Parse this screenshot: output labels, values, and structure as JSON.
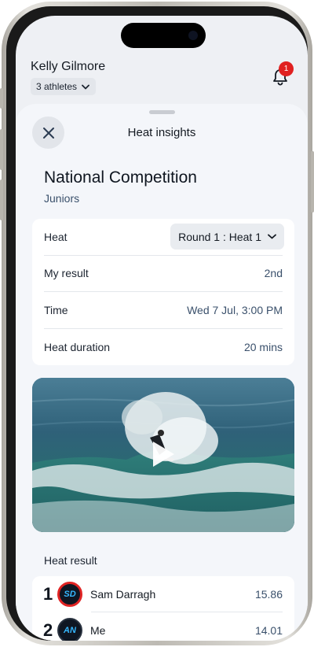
{
  "header": {
    "user_name": "Kelly Gilmore",
    "athletes_label": "3 athletes",
    "notification_count": "1"
  },
  "sheet": {
    "title": "Heat insights",
    "competition": "National Competition",
    "division": "Juniors"
  },
  "info": {
    "heat_label": "Heat",
    "heat_value": "Round 1 : Heat 1",
    "result_label": "My result",
    "result_value": "2nd",
    "time_label": "Time",
    "time_value": "Wed 7 Jul, 3:00 PM",
    "duration_label": "Heat duration",
    "duration_value": "20 mins"
  },
  "results": {
    "heading": "Heat result",
    "rows": [
      {
        "rank": "1",
        "initials": "SD",
        "name": "Sam Darragh",
        "score": "15.86"
      },
      {
        "rank": "2",
        "initials": "AN",
        "name": "Me",
        "score": "14.01"
      }
    ]
  },
  "colors": {
    "badge": "#e02020",
    "accent_initials": "#36b8ff",
    "winner_ring": "#e02424"
  }
}
